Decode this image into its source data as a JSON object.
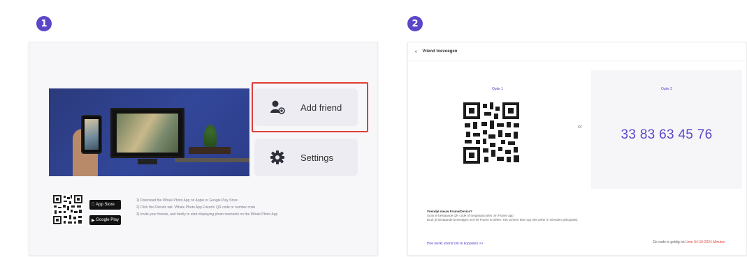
{
  "steps": [
    "1",
    "2"
  ],
  "panel1": {
    "add_friend_label": "Add friend",
    "settings_label": "Settings",
    "store_badges": [
      "App Store",
      "Google Play"
    ],
    "instructions": [
      "1) Download the Whale Photo App on Apple or Google Play Store",
      "2) Click the Friends tab: 'Whale Photo App Friends' QR code or number code",
      "3) Invite your friends, and family to start displaying photo moments on the Whale Photo App"
    ]
  },
  "panel2": {
    "header_title": "Vriend toevoegen",
    "option1_label": "Optie 1",
    "option2_label": "Optie 2",
    "or_label": "or",
    "code": "33 83 63 45 76",
    "help_title": "Vriendje nieuw Frame/Device?",
    "help_lines": [
      "Scan je bestaande QR code of toegangscodes om Frame app",
      "Druk je bestaande bevestigen om het Frame te delen. Het scherm kan nog niet zeker in vrienden gekoppeld."
    ],
    "footer_link": "Hoe werkt vriend om te koppelen >>",
    "footer_right_prefix": "De code is geldig tot",
    "footer_right_highlight": "Uren 04-10-2024 Minuten"
  },
  "colors": {
    "accent": "#5b46c9",
    "highlight_border": "#e23b3b",
    "hero_bg": "#2f4290"
  }
}
